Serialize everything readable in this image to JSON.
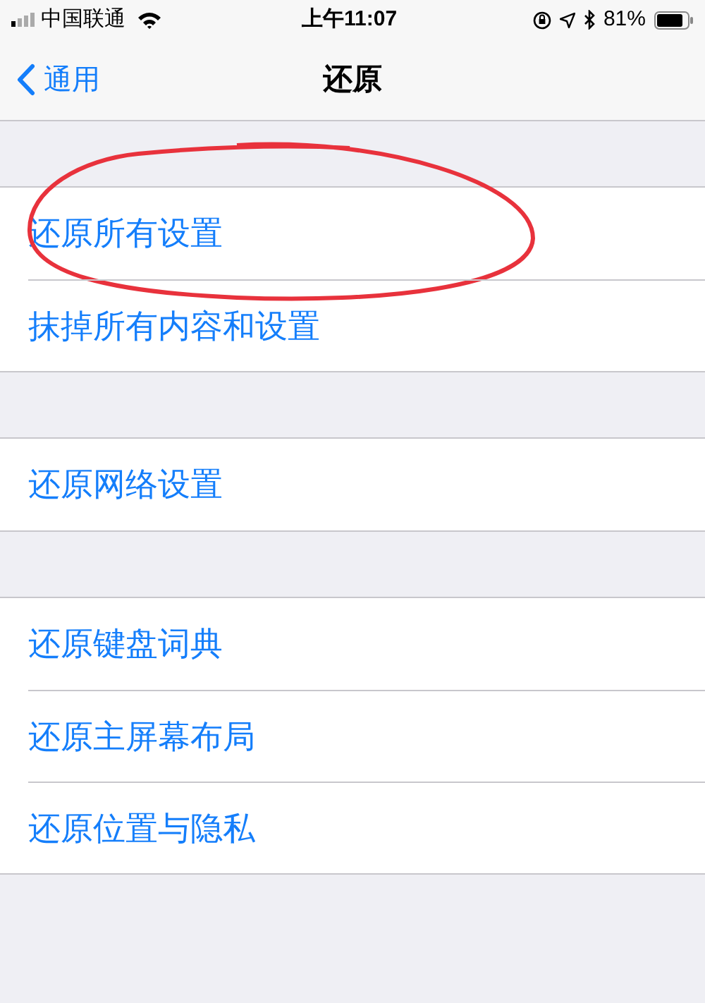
{
  "status_bar": {
    "carrier": "中国联通",
    "time": "上午11:07",
    "battery_text": "81%"
  },
  "nav": {
    "back": "通用",
    "title": "还原"
  },
  "groups": [
    {
      "items": [
        {
          "label": "还原所有设置",
          "circled": true
        },
        {
          "label": "抹掉所有内容和设置",
          "circled": false
        }
      ]
    },
    {
      "items": [
        {
          "label": "还原网络设置",
          "circled": false
        }
      ]
    },
    {
      "items": [
        {
          "label": "还原键盘词典",
          "circled": false
        },
        {
          "label": "还原主屏幕布局",
          "circled": false
        },
        {
          "label": "还原位置与隐私",
          "circled": false
        }
      ]
    }
  ]
}
